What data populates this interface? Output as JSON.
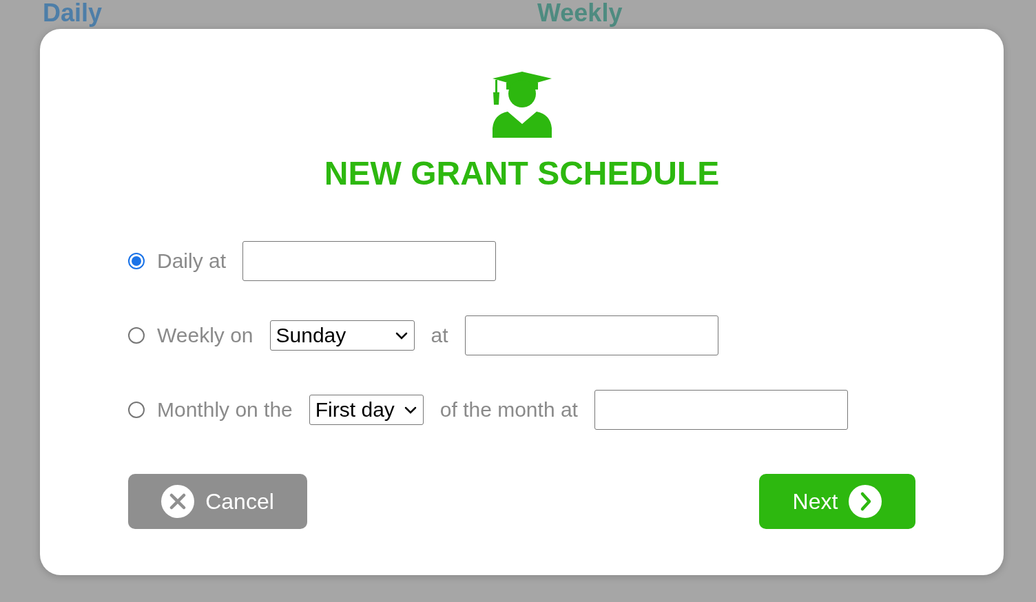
{
  "background_headings": [
    {
      "text": "Daily",
      "color": "#4d7ea8"
    },
    {
      "text": "Weekly",
      "color": "#4e8b80"
    }
  ],
  "dialog": {
    "title": "NEW GRANT SCHEDULE",
    "options": [
      {
        "selected": true,
        "parts": [
          {
            "kind": "text",
            "text": "Daily at"
          },
          {
            "kind": "field"
          }
        ]
      },
      {
        "selected": false,
        "parts": [
          {
            "kind": "text",
            "text": "Weekly on"
          },
          {
            "kind": "dropdown",
            "value": "Sunday"
          },
          {
            "kind": "text",
            "text": "at"
          },
          {
            "kind": "field"
          }
        ]
      },
      {
        "selected": false,
        "parts": [
          {
            "kind": "text",
            "text": "Monthly on the"
          },
          {
            "kind": "dropdown",
            "value": "First day"
          },
          {
            "kind": "text",
            "text": "of the month at"
          },
          {
            "kind": "field"
          }
        ]
      }
    ],
    "buttons": [
      {
        "kind": "cancel",
        "label": "Cancel"
      },
      {
        "kind": "next",
        "label": "Next"
      }
    ]
  }
}
